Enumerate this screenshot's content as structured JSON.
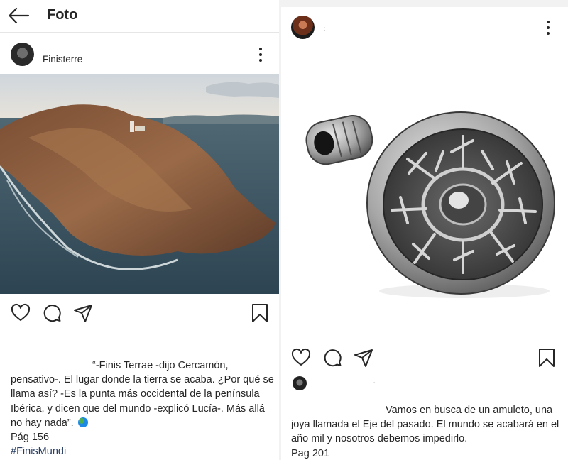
{
  "left_post": {
    "header": {
      "title": "Foto",
      "back_icon": "arrow-left-icon"
    },
    "user": {
      "username": "Finisterre"
    },
    "actions": [
      "heart-icon",
      "comment-icon",
      "share-icon",
      "bookmark-icon"
    ],
    "caption": {
      "text": "“-Finis Terrae -dijo Cercamón, pensativo-. El lugar donde la tierra se acaba. ¿Por qué se llama así? -Es la punta más occidental de la península Ibérica, y dicen que del mundo -explicó Lucía-. Más allá no hay nada”.",
      "page": "Pág 156",
      "hashtag": "#FinisMundi"
    }
  },
  "right_post": {
    "user": {
      "username": ":"
    },
    "comment_marker": "-",
    "actions": [
      "heart-icon",
      "comment-icon",
      "share-icon",
      "bookmark-icon"
    ],
    "caption": {
      "text": "Vamos en busca de un amuleto, una joya llamada el Eje del pasado. El mundo se acabará en el año mil y nosotros debemos impedirlo.",
      "page": "Pag 201"
    }
  },
  "colors": {
    "text": "#262626",
    "hashtag": "#2a3f63",
    "divider": "#f2f2f2",
    "sea": "#3f5d6c",
    "rock": "#8a5a3a",
    "silver": "#b8b8b8"
  }
}
